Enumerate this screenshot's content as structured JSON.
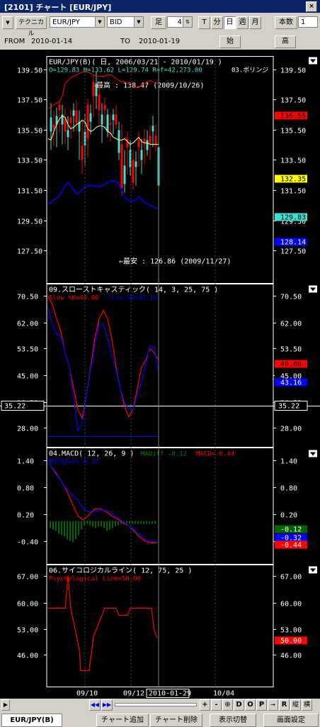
{
  "window": {
    "title": "[2101] チャート [EUR/JPY]",
    "close": "×"
  },
  "toolbar": {
    "technical": "テクニカル",
    "symbol": "EUR/JPY",
    "side": "BID",
    "ashi_label": "足",
    "ashi_value": "4",
    "period_buttons": [
      "T",
      "分",
      "日",
      "週",
      "月"
    ],
    "period_selected": "日",
    "bars_label": "本数",
    "bars_value": "1"
  },
  "range": {
    "from_label": "FROM",
    "from": "2010-01-14",
    "to_label": "TO",
    "to": "2010-01-19",
    "start_btn": "始",
    "high_btn": "高"
  },
  "panels": {
    "price": {
      "title": "EUR/JPY(B)( 日, 2006/03/21 - 2010/01/19 )",
      "ohlc": "O=129.83 H=133.62 L=129.74 R=f=42,273.00",
      "bollinger": "03.ボリンジ",
      "high_note": "←最高 : 138.47 (2009/10/26)",
      "low_note": "←最安 : 126.86 (2009/11/27)",
      "y_labels": [
        "139.50",
        "137.50",
        "135.50",
        "133.50",
        "131.50",
        "129.50",
        "127.50"
      ],
      "badges": [
        {
          "text": "136.55",
          "bg": "#ff0000",
          "fg": "#000000"
        },
        {
          "text": "132.35",
          "bg": "#ffff00",
          "fg": "#000000"
        },
        {
          "text": "129.83",
          "bg": "#40e0d0",
          "fg": "#000000"
        },
        {
          "text": "128.14",
          "bg": "#0000ff",
          "fg": "#ffffff"
        }
      ]
    },
    "stoch": {
      "title": "09.スローストキャスティック( 14, 3, 25, 75 )",
      "legend_k": "Slow %K=49.00",
      "legend_d": "Slow %D=43.16",
      "y_labels": [
        "70.50",
        "62.00",
        "53.50",
        "45.00",
        "36.52",
        "28.00"
      ],
      "cursor_value": "35.22",
      "badges": [
        {
          "text": "49.00",
          "bg": "#ff0000",
          "fg": "#000000"
        },
        {
          "text": "45.00",
          "bg": "#000000",
          "fg": "#ffffff"
        },
        {
          "text": "43.16",
          "bg": "#0000ff",
          "fg": "#ffffff"
        }
      ]
    },
    "macd": {
      "title": "04.MACD( 12, 26, 9 )",
      "diff": "MADiff -0.12",
      "macd": "MACD=-0.44",
      "avg": "MACDAve=-0.32",
      "y_labels": [
        "1.40",
        "0.80",
        "0.20",
        "-0.40"
      ],
      "badges": [
        {
          "text": "-0.12",
          "bg": "#006400",
          "fg": "#ffffff"
        },
        {
          "text": "-0.32",
          "bg": "#0000ff",
          "fg": "#ffffff"
        },
        {
          "text": "-0.44",
          "bg": "#ff0000",
          "fg": "#ffffff"
        }
      ]
    },
    "psy": {
      "title": "06.サイコロジカルライン( 12, 75, 25 )",
      "legend": "Psychological Line=50.00",
      "y_labels": [
        "67.00",
        "60.00",
        "53.00",
        "46.00"
      ],
      "badges": [
        {
          "text": "50.00",
          "bg": "#ff0000",
          "fg": "#ffffff"
        }
      ]
    }
  },
  "x_axis": {
    "labels": [
      "09/10",
      "09/12",
      "2010-01-29",
      "10/04"
    ]
  },
  "bottom_buttons": [
    "+",
    "-",
    "⊕",
    "D",
    "O",
    "P",
    "R",
    "縦",
    "横"
  ],
  "tabs": [
    "EUR/JPY(B)",
    "チャート追加",
    "チャート削除",
    "表示切替",
    "画面設定"
  ]
}
